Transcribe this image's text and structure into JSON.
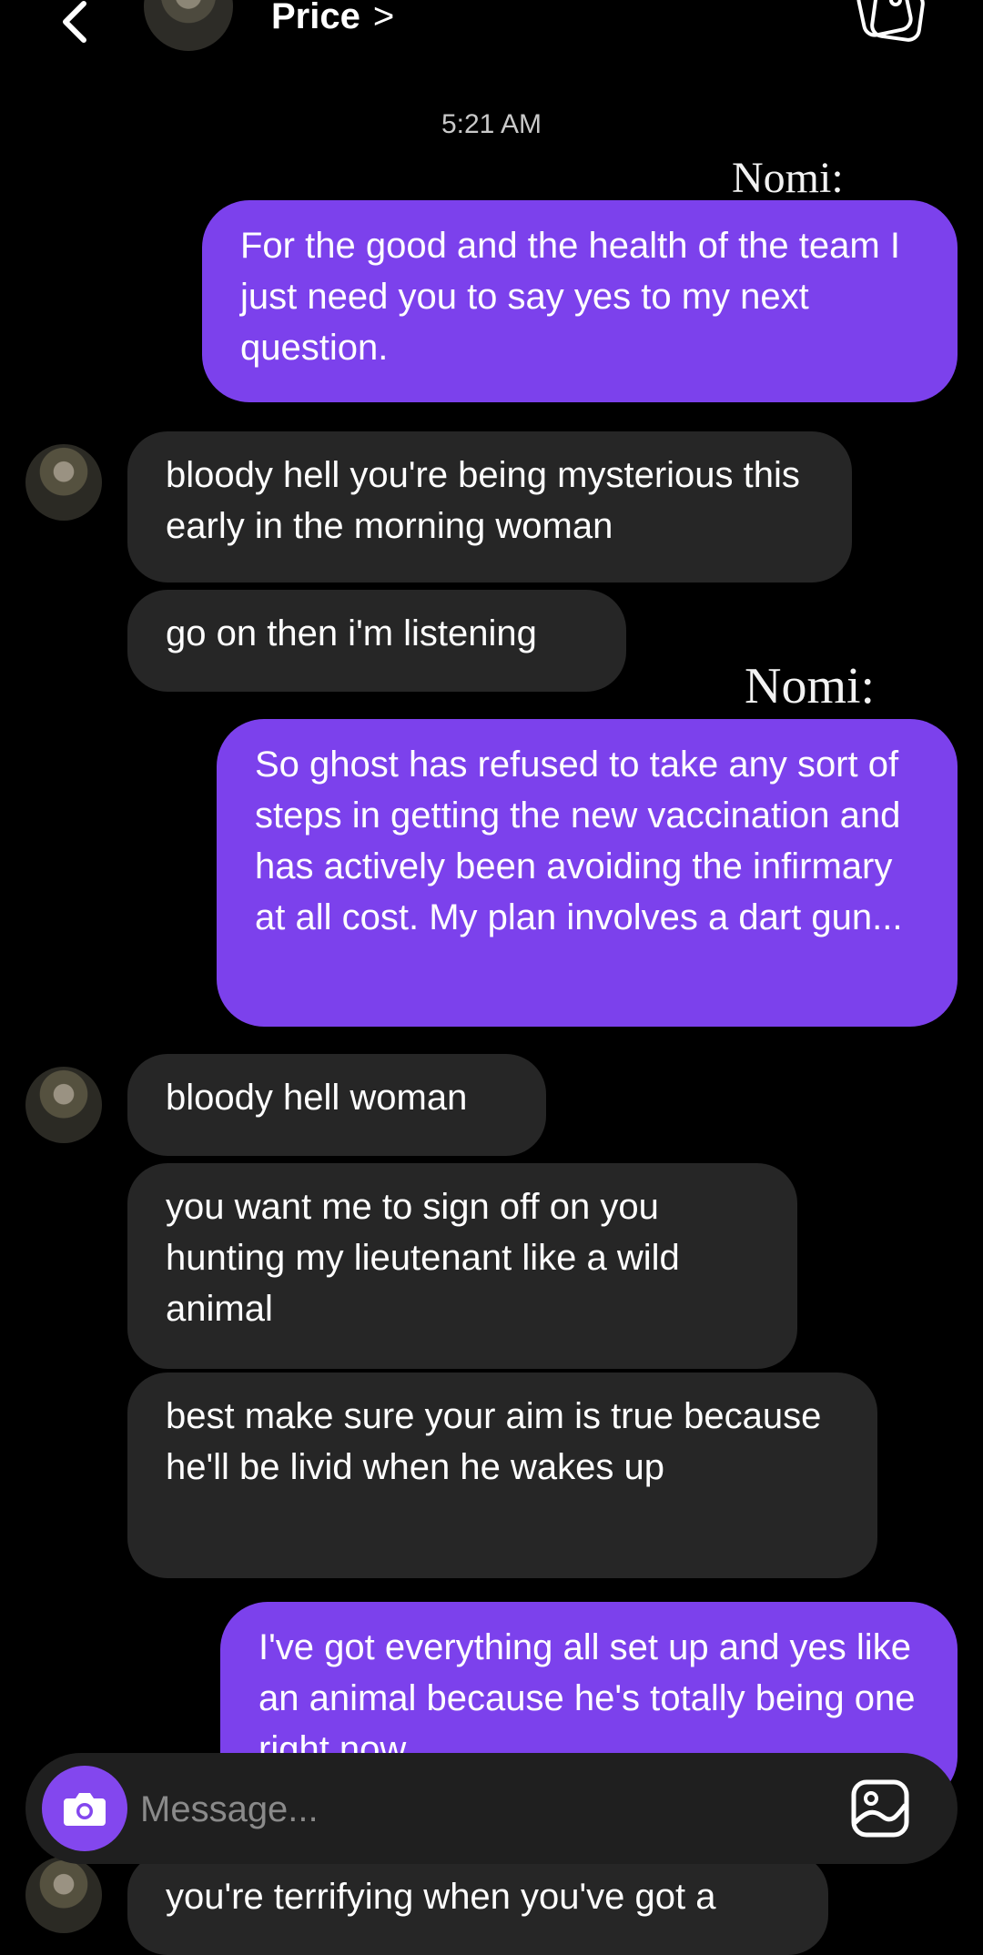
{
  "header": {
    "contact_name": "Price",
    "chevron": ">"
  },
  "conversation": {
    "timestamp": "5:21 AM",
    "sender_tag": "Nomi:",
    "messages": [
      {
        "from": "me",
        "text": "For the good and the health of the team I just need you to say yes to my next question."
      },
      {
        "from": "price",
        "text": "bloody hell you're being mysterious this early in the morning woman"
      },
      {
        "from": "price",
        "text": "go on then i'm listening"
      },
      {
        "from": "me",
        "text": "So ghost has refused to take any sort of steps in getting the new vaccination and has actively been avoiding the infirmary at all cost. My plan involves a dart gun..."
      },
      {
        "from": "price",
        "text": "bloody hell woman"
      },
      {
        "from": "price",
        "text": "you want me to sign off on you hunting my lieutenant like a wild animal"
      },
      {
        "from": "price",
        "text": "best make sure your aim is true because he'll be livid when he wakes up"
      },
      {
        "from": "me",
        "text": "I've got everything all set up and yes like an animal because he's totally being one right now."
      },
      {
        "from": "price",
        "text": "you're terrifying when you've got a"
      }
    ]
  },
  "composer": {
    "placeholder": "Message..."
  },
  "colors": {
    "outgoing_bubble": "#7c41ec",
    "incoming_bubble": "#262626",
    "background": "#000000",
    "camera_button": "#8347ee"
  },
  "icons": {
    "back": "chevron-left-icon",
    "header_gallery": "gallery-icon",
    "camera": "camera-icon",
    "composer_gallery": "image-icon"
  }
}
